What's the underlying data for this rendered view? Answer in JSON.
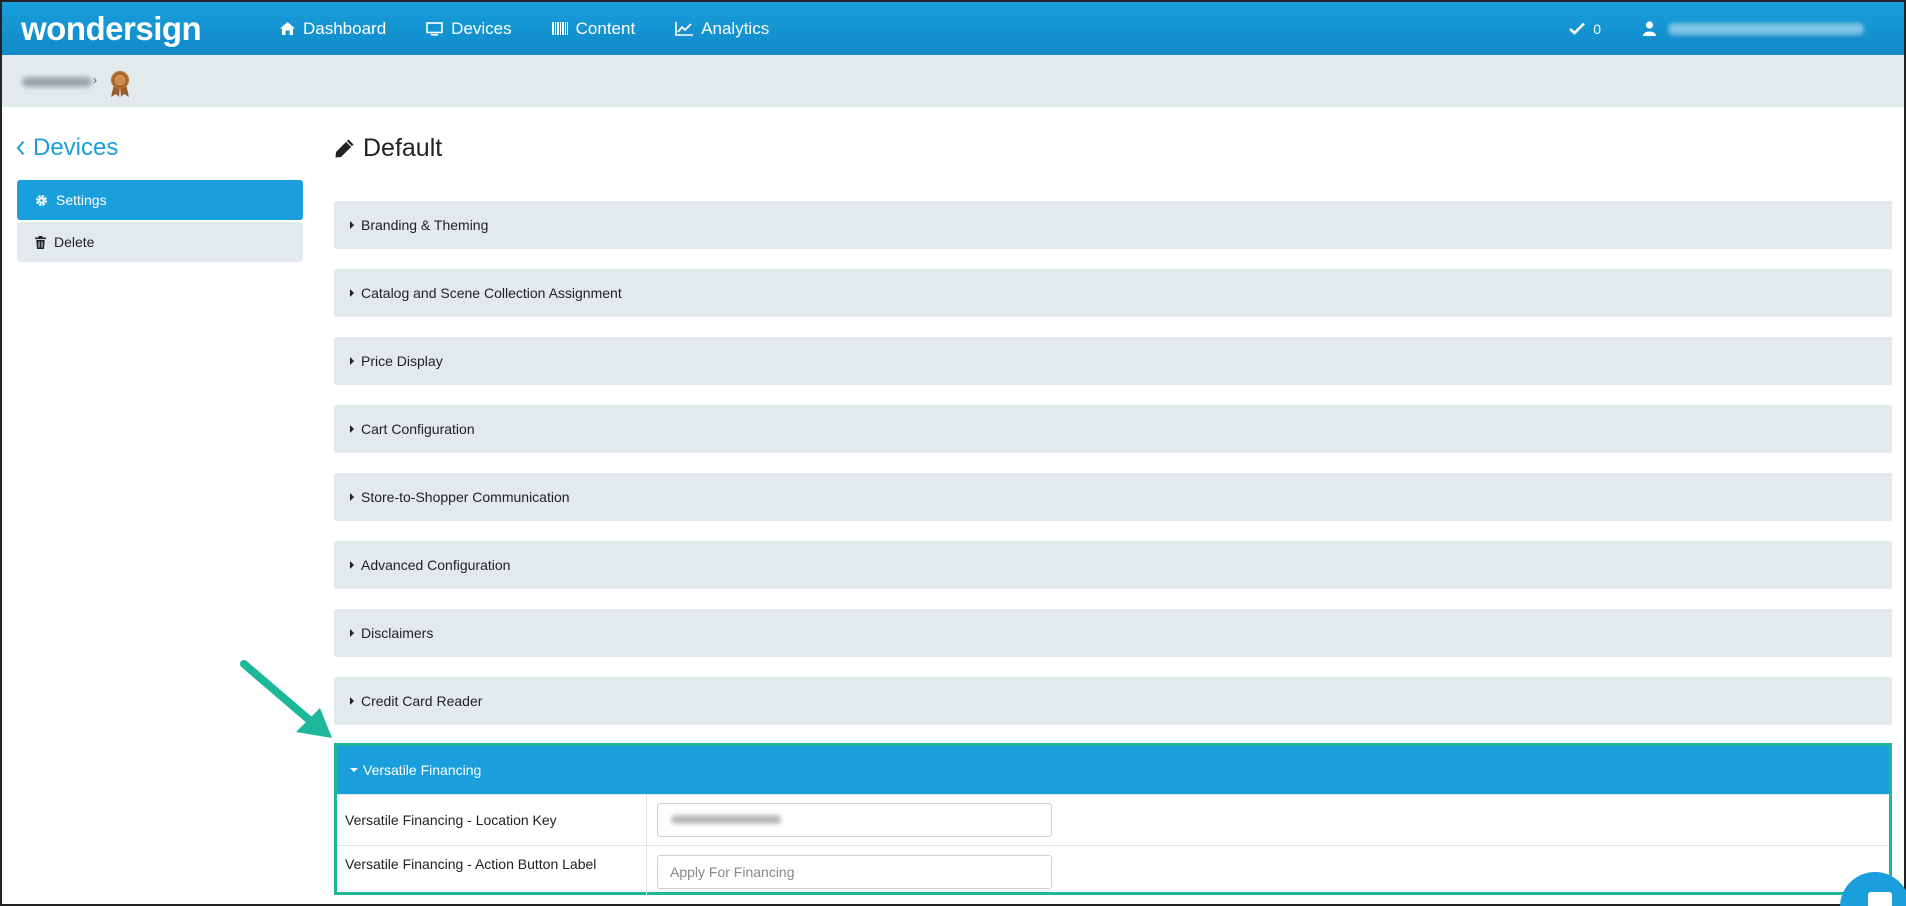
{
  "header": {
    "logo": "wondersign",
    "nav": [
      {
        "label": "Dashboard",
        "icon": "home-icon"
      },
      {
        "label": "Devices",
        "icon": "monitor-icon"
      },
      {
        "label": "Content",
        "icon": "barcode-icon"
      },
      {
        "label": "Analytics",
        "icon": "line-chart-icon"
      }
    ],
    "tasks_count": "0"
  },
  "sidebar": {
    "back_label": "Devices",
    "items": [
      {
        "label": "Settings",
        "icon": "gear-icon",
        "active": true
      },
      {
        "label": "Delete",
        "icon": "trash-icon",
        "active": false
      }
    ]
  },
  "main": {
    "title": "Default",
    "panels": [
      "Branding & Theming",
      "Catalog and Scene Collection Assignment",
      "Price Display",
      "Cart Configuration",
      "Store-to-Shopper Communication",
      "Advanced Configuration",
      "Disclaimers",
      "Credit Card Reader"
    ],
    "open_panel": {
      "title": "Versatile Financing",
      "rows": [
        {
          "label": "Versatile Financing - Location Key",
          "value": "",
          "placeholder": ""
        },
        {
          "label": "Versatile Financing - Action Button Label",
          "value": "",
          "placeholder": "Apply For Financing"
        }
      ]
    }
  },
  "colors": {
    "brand": "#1a9fdc",
    "highlight": "#1db89a",
    "panel_bg": "#e3eaed"
  }
}
